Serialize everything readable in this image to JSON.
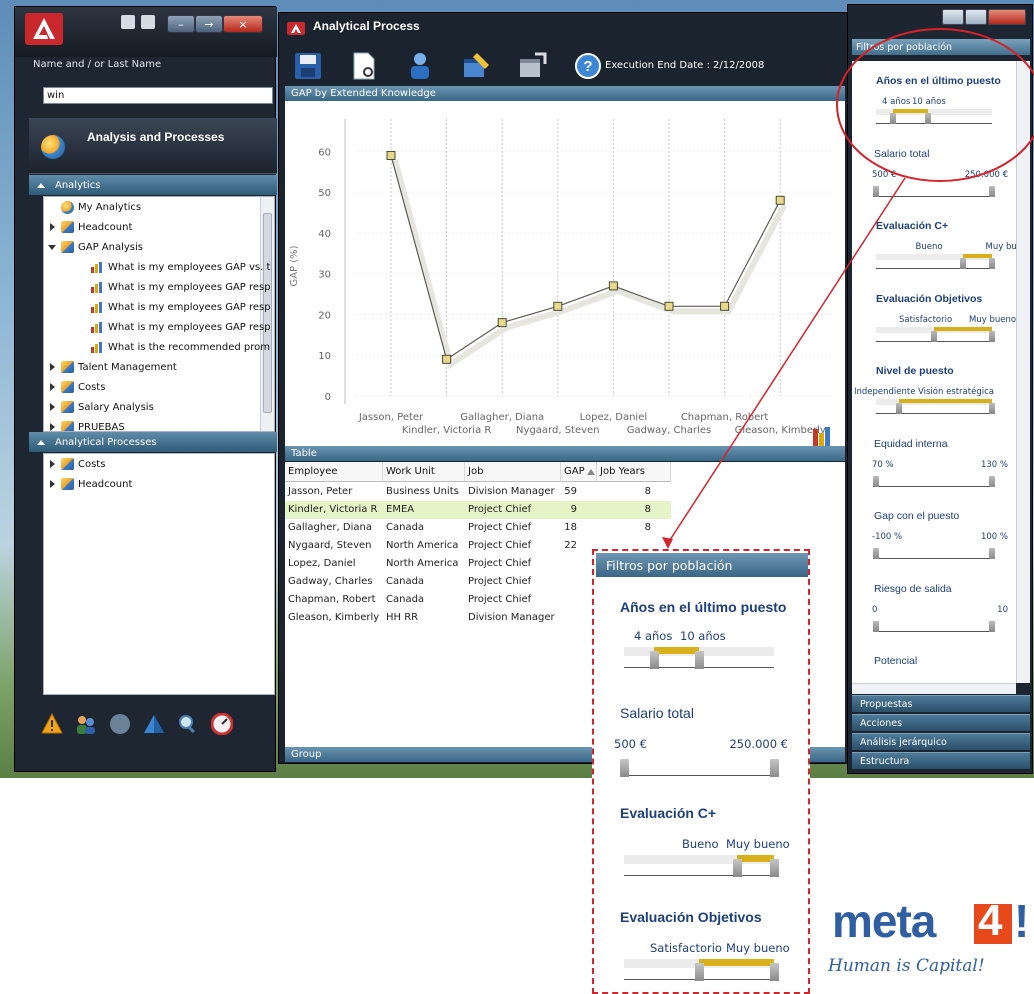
{
  "left_panel": {
    "name_label": "Name and / or Last Name",
    "name_value": "win",
    "header_title": "Analysis and Processes",
    "analytics_section": "Analytics",
    "analytics_tree": [
      {
        "label": "My Analytics",
        "icon": "globe-icon",
        "expander": "none",
        "indent": 0
      },
      {
        "label": "Headcount",
        "icon": "cube-icon",
        "expander": "closed",
        "indent": 0
      },
      {
        "label": "GAP Analysis",
        "icon": "cube-icon",
        "expander": "open",
        "indent": 0
      },
      {
        "label": "What is my employees GAP vs. t",
        "icon": "bar-chart-icon",
        "expander": "none",
        "indent": 1
      },
      {
        "label": "What is my employees GAP resp",
        "icon": "bar-chart-icon",
        "expander": "none",
        "indent": 1
      },
      {
        "label": "What is my employees GAP resp",
        "icon": "bar-chart-icon",
        "expander": "none",
        "indent": 1
      },
      {
        "label": "What is my employees GAP resp",
        "icon": "bar-chart-icon",
        "expander": "none",
        "indent": 1
      },
      {
        "label": "What is the recommended prom",
        "icon": "bar-chart-icon",
        "expander": "none",
        "indent": 1
      },
      {
        "label": "Talent Management",
        "icon": "cube-icon",
        "expander": "closed",
        "indent": 0
      },
      {
        "label": "Costs",
        "icon": "cube-icon",
        "expander": "closed",
        "indent": 0
      },
      {
        "label": "Salary Analysis",
        "icon": "cube-icon",
        "expander": "closed",
        "indent": 0
      },
      {
        "label": "PRUEBAS",
        "icon": "cube-icon",
        "expander": "closed",
        "indent": 0
      }
    ],
    "processes_section": "Analytical Processes",
    "processes_tree": [
      {
        "label": "Costs",
        "icon": "cube-icon",
        "expander": "closed"
      },
      {
        "label": "Headcount",
        "icon": "cube-icon",
        "expander": "closed"
      }
    ]
  },
  "main": {
    "title": "Analytical Process",
    "execution_date": "Execution End Date : 2/12/2008",
    "chart_bar_title": "GAP by Extended Knowledge",
    "table_bar_title": "Table",
    "group_bar_title": "Group",
    "table": {
      "columns": [
        "Employee",
        "Work Unit",
        "Job",
        "GAP",
        "Job Years"
      ],
      "rows": [
        [
          "Jasson, Peter",
          "Business Units",
          "Division Manager",
          "59",
          "8"
        ],
        [
          "Kindler, Victoria R",
          "EMEA",
          "Project Chief",
          "9",
          "8"
        ],
        [
          "Gallagher, Diana",
          "Canada",
          "Project Chief",
          "18",
          "8"
        ],
        [
          "Nygaard, Steven",
          "North America",
          "Project Chief",
          "22",
          ""
        ],
        [
          "Lopez, Daniel",
          "North America",
          "Project Chief",
          "",
          ""
        ],
        [
          "Gadway, Charles",
          "Canada",
          "Project Chief",
          "",
          ""
        ],
        [
          "Chapman, Robert",
          "Canada",
          "Project Chief",
          "",
          ""
        ],
        [
          "Gleason, Kimberly",
          "HH RR",
          "Division Manager",
          "",
          ""
        ]
      ],
      "selected_row": 1
    }
  },
  "chart_data": {
    "type": "line",
    "title": "",
    "xlabel": "",
    "ylabel": "GAP (%)",
    "ylim": [
      0,
      65
    ],
    "yticks": [
      0,
      10,
      20,
      30,
      40,
      50,
      60
    ],
    "grid": true,
    "categories": [
      "Jasson, Peter",
      "Kindler, Victoria R",
      "Gallagher, Diana",
      "Nygaard, Steven",
      "Lopez, Daniel",
      "Gadway, Charles",
      "Chapman, Robert",
      "Gleason, Kimberly"
    ],
    "series": [
      {
        "values": [
          59,
          9,
          18,
          22,
          27,
          22,
          22,
          48
        ],
        "color": "#7a7a6a"
      }
    ]
  },
  "right_panel": {
    "header": "Filtros por población",
    "filters": [
      {
        "title": "Años en el último puesto",
        "bold": true,
        "low": "4 años",
        "high": "10 años",
        "range": [
          0.15,
          0.45
        ]
      },
      {
        "title": "Salario total",
        "bold": false,
        "low": "500 €",
        "high": "250.000 €",
        "range": [
          0,
          1
        ]
      },
      {
        "title": "Evaluación C+",
        "bold": true,
        "low": "Bueno",
        "high": "Muy bueno",
        "range": [
          0.75,
          1
        ]
      },
      {
        "title": "Evaluación Objetivos",
        "bold": true,
        "low": "Satisfactorio",
        "high": "Muy bueno",
        "range": [
          0.5,
          1
        ]
      },
      {
        "title": "Nivel de puesto",
        "bold": true,
        "low": "Independiente",
        "high": "Visión estratégica",
        "range": [
          0.2,
          1
        ]
      },
      {
        "title": "Equidad interna",
        "bold": false,
        "low": "70 %",
        "high": "130 %",
        "range": [
          0,
          1
        ]
      },
      {
        "title": "Gap con el puesto",
        "bold": false,
        "low": "-100 %",
        "high": "100 %",
        "range": [
          0,
          1
        ]
      },
      {
        "title": "Riesgo de salida",
        "bold": false,
        "low": "0",
        "high": "10",
        "range": [
          0,
          1
        ]
      },
      {
        "title": "Potencial",
        "bold": false,
        "low": "",
        "high": "",
        "range": [
          0,
          1
        ]
      }
    ],
    "sections": [
      "Propuestas",
      "Acciones",
      "Análisis jerárquico",
      "Estructura"
    ]
  },
  "zoom": {
    "header": "Filtros por población",
    "filters": [
      {
        "title": "Años en el último puesto",
        "low": "4 años",
        "high": "10 años"
      },
      {
        "title": "Salario total",
        "low": "500 €",
        "high": "250.000 €"
      },
      {
        "title": "Evaluación C+",
        "low": "Bueno",
        "high": "Muy bueno"
      },
      {
        "title": "Evaluación Objetivos",
        "low": "Satisfactorio",
        "high": "Muy bueno"
      }
    ]
  },
  "brand": {
    "word": "meta",
    "digit": "4",
    "bang": "!",
    "tagline": "Human is Capital!"
  },
  "colors": {
    "accent_gold": "#d8b01a",
    "callout_red": "#d4232b",
    "brand_blue": "#2f5fa2",
    "brand_orange": "#e8491b",
    "selected_row": "#e4f4c6"
  }
}
